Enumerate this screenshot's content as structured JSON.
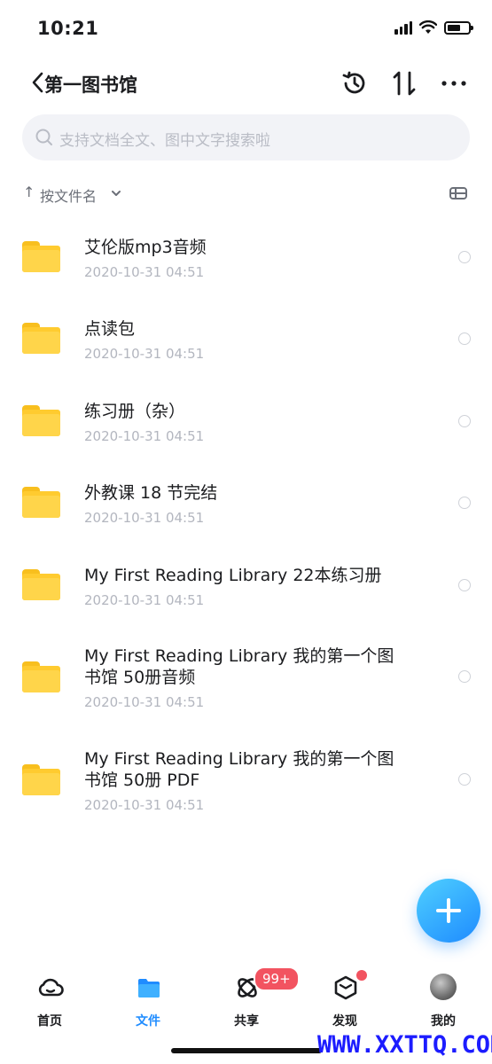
{
  "status": {
    "time": "10:21"
  },
  "header": {
    "title": "第一图书馆"
  },
  "search": {
    "placeholder": "支持文档全文、图中文字搜索啦"
  },
  "sort": {
    "arrow": "↑",
    "label": "按文件名"
  },
  "files": [
    {
      "name": "艾伦版mp3音频",
      "date": "2020-10-31 04:51"
    },
    {
      "name": "点读包",
      "date": "2020-10-31 04:51"
    },
    {
      "name": "练习册（杂）",
      "date": "2020-10-31 04:51"
    },
    {
      "name": "外教课 18 节完结",
      "date": "2020-10-31 04:51"
    },
    {
      "name": "My First Reading Library 22本练习册",
      "date": "2020-10-31 04:51"
    },
    {
      "name": "My First Reading Library 我的第一个图书馆 50册音频",
      "date": "2020-10-31 04:51"
    },
    {
      "name": "My First Reading Library 我的第一个图书馆 50册 PDF",
      "date": "2020-10-31 04:51"
    }
  ],
  "tabbar": {
    "tabs": [
      {
        "label": "首页",
        "icon": "cloud-icon"
      },
      {
        "label": "文件",
        "icon": "folder-icon",
        "active": true
      },
      {
        "label": "共享",
        "icon": "orbit-icon",
        "badge": "99+"
      },
      {
        "label": "发现",
        "icon": "cube-icon",
        "dot": true
      },
      {
        "label": "我的",
        "icon": "avatar"
      }
    ]
  },
  "colors": {
    "accent": "#1f8cff",
    "folder": "#ffcb2f",
    "badge": "#f25360"
  },
  "watermark": "WWW.XXTTQ.COM"
}
